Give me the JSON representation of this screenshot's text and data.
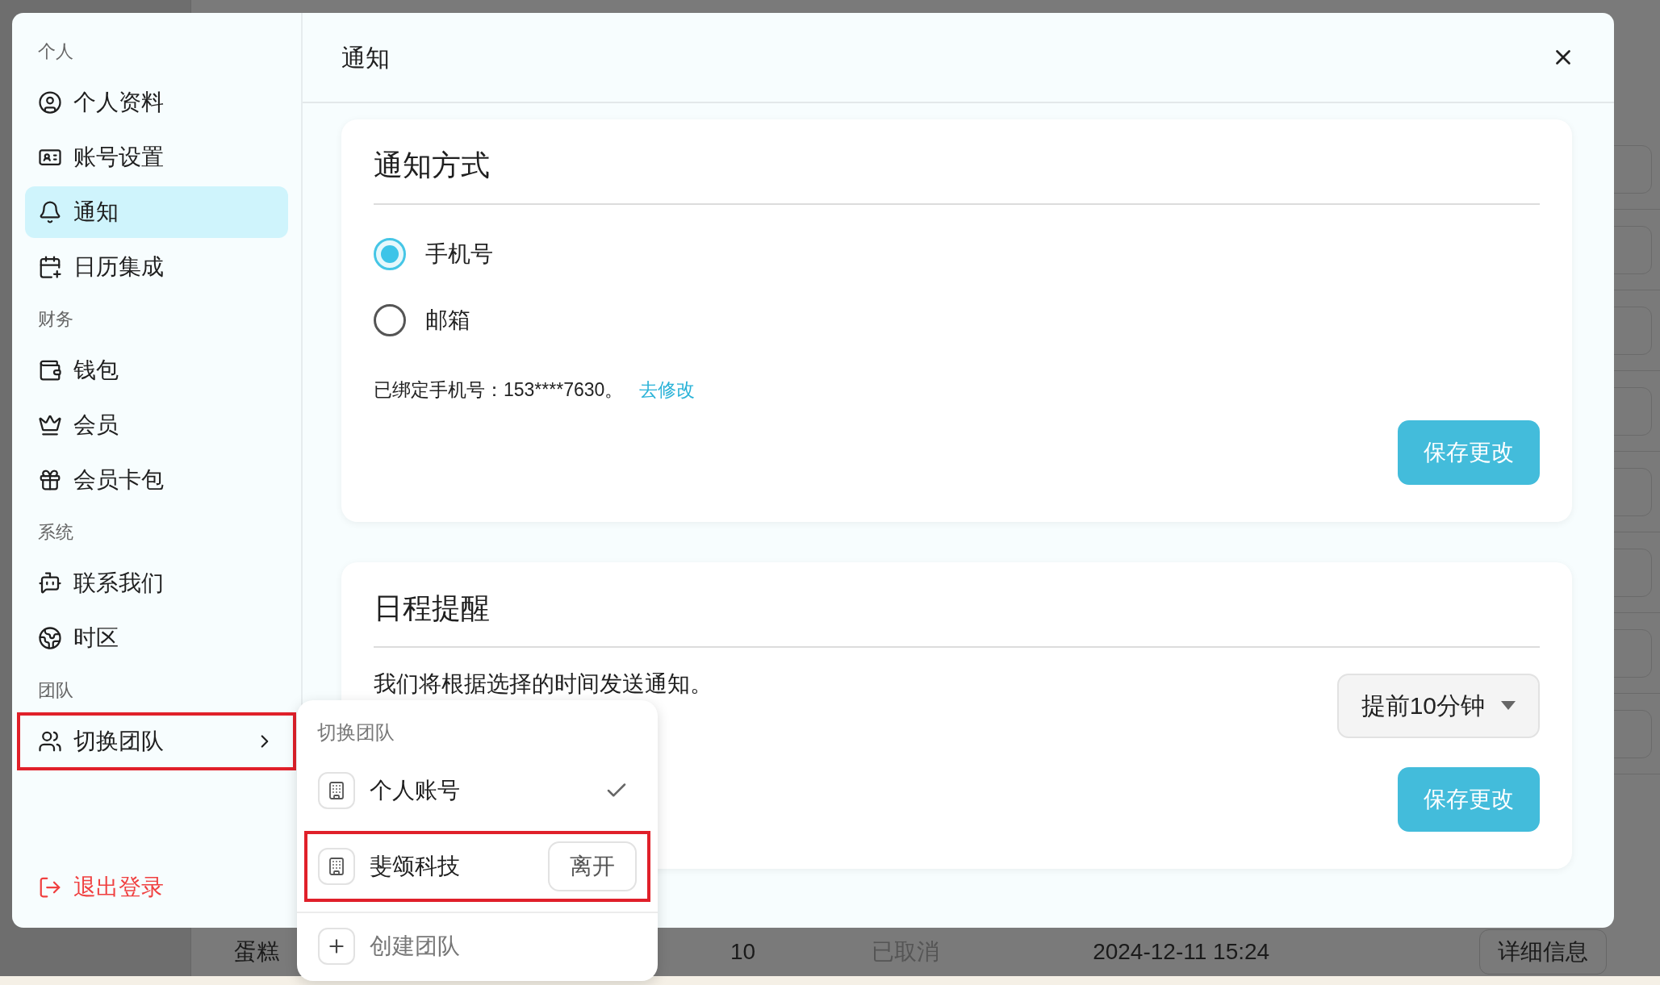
{
  "background": {
    "row": {
      "name": "蛋糕",
      "quantity": "10",
      "status": "已取消",
      "time": "2024-12-11 15:24",
      "action": "详细信息"
    }
  },
  "dialog": {
    "title": "通知",
    "sidebar": {
      "groups": [
        {
          "heading": "个人",
          "items": [
            {
              "label": "个人资料",
              "selected": false,
              "outlined": false
            },
            {
              "label": "账号设置",
              "selected": false,
              "outlined": false
            },
            {
              "label": "通知",
              "selected": true,
              "outlined": false
            },
            {
              "label": "日历集成",
              "selected": false,
              "outlined": false
            }
          ]
        },
        {
          "heading": "财务",
          "items": [
            {
              "label": "钱包",
              "selected": false,
              "outlined": false
            },
            {
              "label": "会员",
              "selected": false,
              "outlined": false
            },
            {
              "label": "会员卡包",
              "selected": false,
              "outlined": false
            }
          ]
        },
        {
          "heading": "系统",
          "items": [
            {
              "label": "联系我们",
              "selected": false,
              "outlined": false
            },
            {
              "label": "时区",
              "selected": false,
              "outlined": false
            }
          ]
        },
        {
          "heading": "团队",
          "items": [
            {
              "label": "切换团队",
              "selected": false,
              "outlined": true,
              "submenu": true
            }
          ]
        }
      ],
      "logout": "退出登录"
    },
    "notify_card": {
      "title": "通知方式",
      "options": [
        {
          "label": "手机号",
          "selected": true
        },
        {
          "label": "邮箱",
          "selected": false
        }
      ],
      "bound_text": "已绑定手机号：153****7630。",
      "link": "去修改",
      "button": "保存更改"
    },
    "schedule_card": {
      "title": "日程提醒",
      "description": "我们将根据选择的时间发送通知。",
      "select": "提前10分钟",
      "button": "保存更改"
    }
  },
  "team_menu": {
    "heading": "切换团队",
    "teams": [
      {
        "name": "个人账号",
        "selected": true,
        "outlined": false
      },
      {
        "name": "斐颂科技",
        "selected": false,
        "outlined": true,
        "action": "离开"
      }
    ],
    "create": "创建团队"
  }
}
